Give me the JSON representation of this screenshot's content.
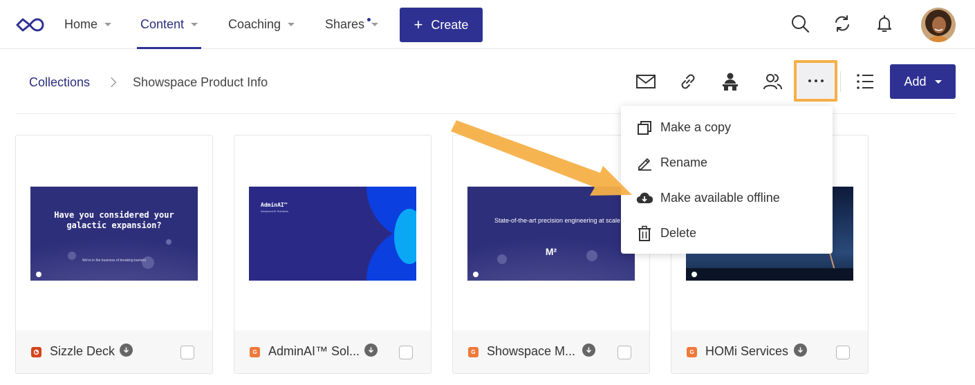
{
  "nav": {
    "items": [
      {
        "label": "Home"
      },
      {
        "label": "Content"
      },
      {
        "label": "Coaching"
      },
      {
        "label": "Shares"
      }
    ],
    "create_label": "Create",
    "create_icon": "+"
  },
  "breadcrumb": {
    "root": "Collections",
    "current": "Showspace Product Info"
  },
  "toolbar": {
    "add_label": "Add"
  },
  "menu": {
    "items": [
      {
        "label": "Make a copy",
        "icon": "copy-icon"
      },
      {
        "label": "Rename",
        "icon": "pencil-icon"
      },
      {
        "label": "Make available offline",
        "icon": "cloud-download-icon"
      },
      {
        "label": "Delete",
        "icon": "trash-icon"
      }
    ]
  },
  "cards": [
    {
      "title": "Sizzle Deck",
      "badge": "",
      "badge_color": "#d4451d",
      "thumb": {
        "headline": "Have you considered your galactic expansion?",
        "caption": "We're in the business of breaking barriers"
      }
    },
    {
      "title": "AdminAI™ Sol...",
      "badge": "G",
      "badge_color": "#f07a3a",
      "thumb": {
        "headline": "AdminAI™",
        "caption": "Advanced AI Solutions"
      }
    },
    {
      "title": "Showspace M...",
      "badge": "G",
      "badge_color": "#f07a3a",
      "thumb": {
        "headline": "State-of-the-art precision engineering at scale",
        "caption": "M²"
      }
    },
    {
      "title": "HOMi Services",
      "badge": "G",
      "badge_color": "#f07a3a",
      "thumb": {
        "headline": "",
        "caption": ""
      }
    }
  ],
  "colors": {
    "primary": "#2e3192",
    "highlight": "#f5b048",
    "arrow": "#f5b048"
  }
}
